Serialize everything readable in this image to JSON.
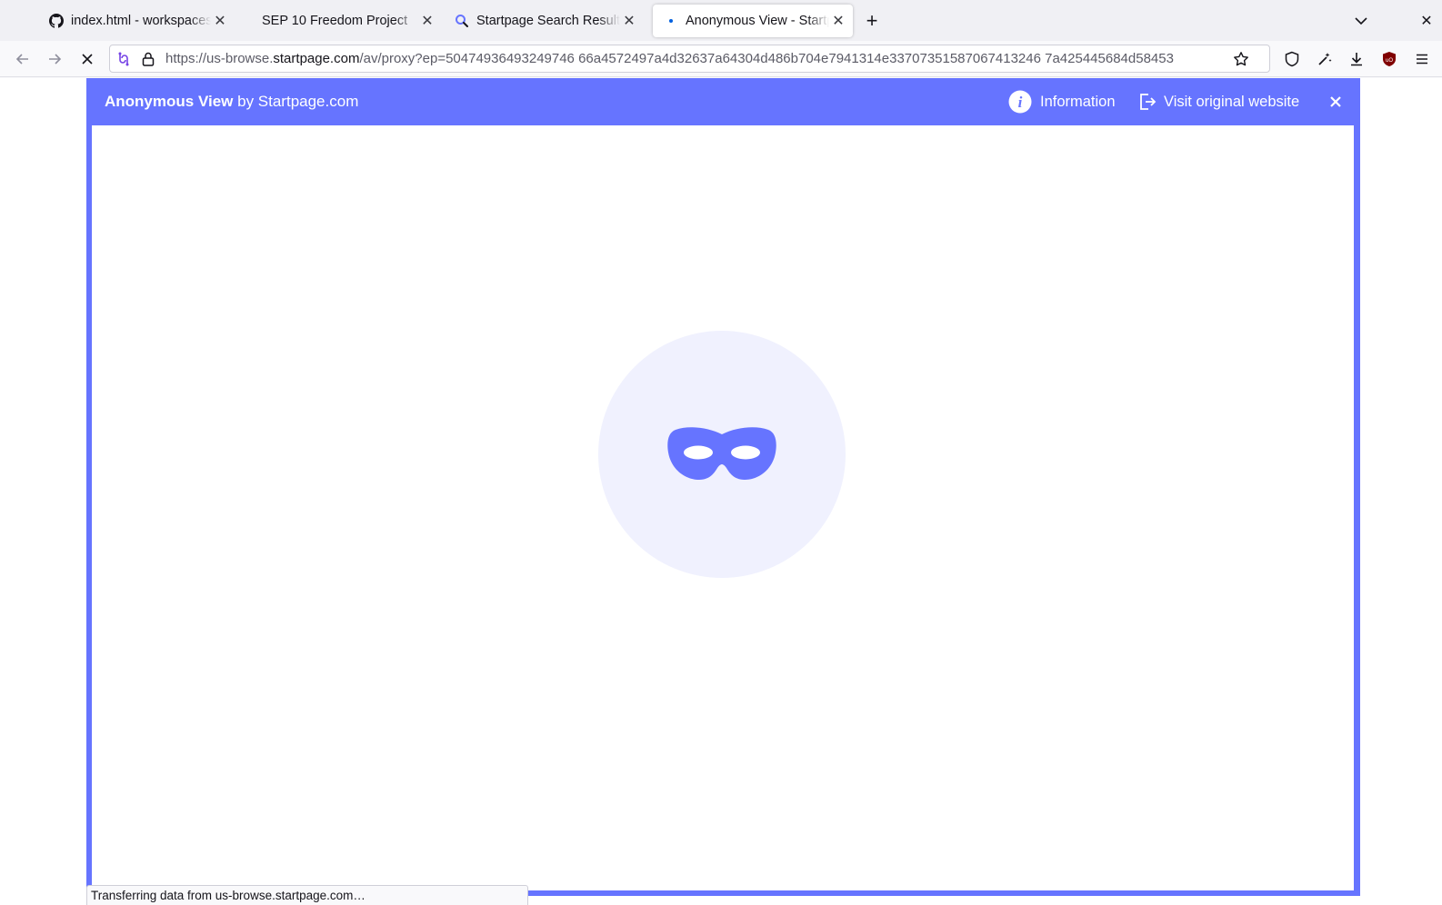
{
  "browser": {
    "tabs": [
      {
        "title": "index.html - workspaces [C",
        "icon": "github-icon"
      },
      {
        "title": "SEP 10 Freedom Project",
        "icon": "none"
      },
      {
        "title": "Startpage Search Results",
        "icon": "startpage-search-icon"
      },
      {
        "title": "Anonymous View - Startpage",
        "icon": "loading-dot",
        "active": true
      }
    ],
    "new_tab_label": "+",
    "url": {
      "prefix": "https://us-browse.",
      "domain": "startpage.com",
      "path": "/av/proxy?ep=50474936493249746 66a4572497a4d32637a64304d486b704e7941314e33707351587067413246 7a425445684d58453"
    }
  },
  "anonymous_view": {
    "title_strong": "Anonymous View",
    "title_rest": " by Startpage.com",
    "info_label": "Information",
    "visit_label": "Visit original website"
  },
  "status": {
    "text": "Transferring data from us-browse.startpage.com…"
  },
  "colors": {
    "accent": "#6674ff",
    "mask_bg": "#f0f1fe"
  }
}
